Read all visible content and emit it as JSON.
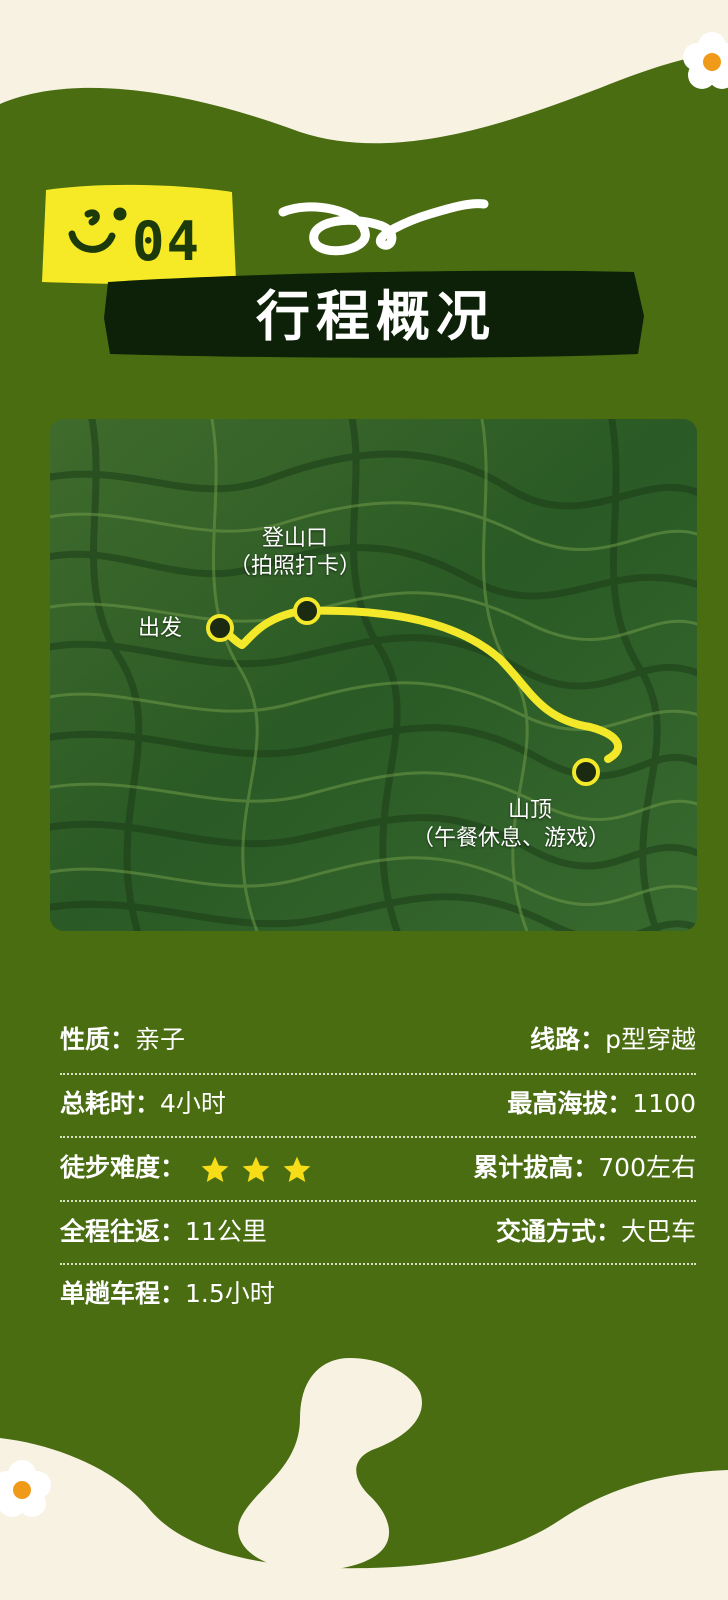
{
  "header": {
    "badge_number": "04",
    "title": "行程概况"
  },
  "map": {
    "start_label": "出发",
    "trailhead_label": "登山口",
    "trailhead_note": "（拍照打卡）",
    "summit_label": "山顶",
    "summit_note": "（午餐休息、游戏）"
  },
  "info": {
    "row1": {
      "left_key": "性质：",
      "left_val": "亲子",
      "right_key": "线路：",
      "right_val": "p型穿越"
    },
    "row2": {
      "left_key": "总耗时：",
      "left_val": "4小时",
      "right_key": "最高海拔：",
      "right_val": "1100"
    },
    "row3": {
      "left_key": "徒步难度：",
      "difficulty_stars": 3,
      "right_key": "累计拔高：",
      "right_val": "700左右"
    },
    "row4": {
      "left_key": "全程往返：",
      "left_val": "11公里",
      "right_key": "交通方式：",
      "right_val": "大巴车"
    },
    "row5": {
      "left_key": "单趟车程：",
      "left_val": "1.5小时"
    }
  },
  "colors": {
    "background": "#f8f2e2",
    "panel_green": "#4a6d12",
    "badge_yellow": "#f5ea25",
    "title_band": "#0d2108",
    "route": "#f3e829",
    "star": "#f6dd18"
  },
  "icons": [
    "smiley-icon",
    "squiggle-decoration",
    "flower-icon",
    "star-icon"
  ]
}
